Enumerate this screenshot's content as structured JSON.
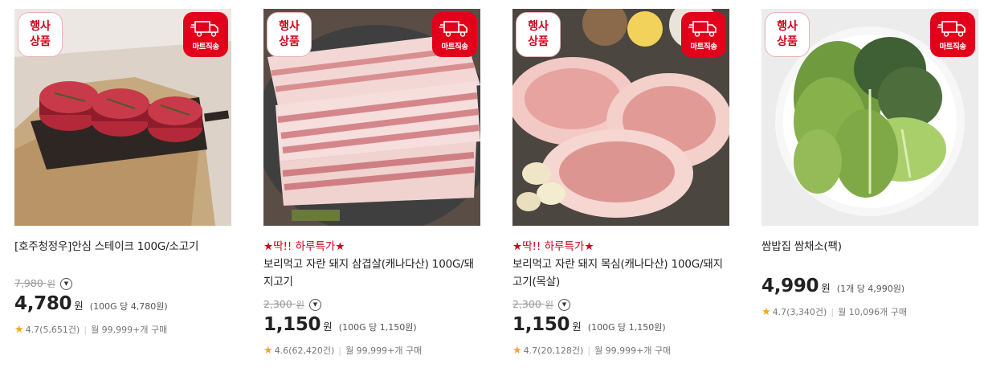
{
  "badges": {
    "event_line1": "행사",
    "event_line2": "상품",
    "delivery": "마트직송"
  },
  "products": [
    {
      "image": "beef-tenderloin-steaks",
      "promo": "",
      "title": "[호주청정우]안심 스테이크 100G/소고기",
      "original_price": "7,980",
      "original_won": "원",
      "price": "4,780",
      "price_won": "원",
      "unit_price": "(100G 당 4,780원)",
      "rating": "4.7(5,651건)",
      "purchases": "월 99,999+개 구매"
    },
    {
      "image": "pork-belly",
      "promo": "★딱!! 하루특가★",
      "title": "보리먹고 자란 돼지 삼겹살(캐나다산) 100G/돼지고기",
      "original_price": "2,300",
      "original_won": "원",
      "price": "1,150",
      "price_won": "원",
      "unit_price": "(100G 당 1,150원)",
      "rating": "4.6(62,420건)",
      "purchases": "월 99,999+개 구매"
    },
    {
      "image": "pork-neck",
      "promo": "★딱!! 하루특가★",
      "title": "보리먹고 자란 돼지 목심(캐나다산) 100G/돼지고기(목살)",
      "original_price": "2,300",
      "original_won": "원",
      "price": "1,150",
      "price_won": "원",
      "unit_price": "(100G 당 1,150원)",
      "rating": "4.7(20,128건)",
      "purchases": "월 99,999+개 구매"
    },
    {
      "image": "ssam-vegetables",
      "promo": "",
      "title": "쌈밥집 쌈채소(팩)",
      "original_price": "",
      "original_won": "",
      "price": "4,990",
      "price_won": "원",
      "unit_price": "(1개 당 4,990원)",
      "rating": "4.7(3,340건)",
      "purchases": "월 10,096개 구매"
    }
  ],
  "colors": {
    "accent_red": "#d0021b",
    "delivery_red": "#e3001b",
    "star": "#f5a623"
  }
}
